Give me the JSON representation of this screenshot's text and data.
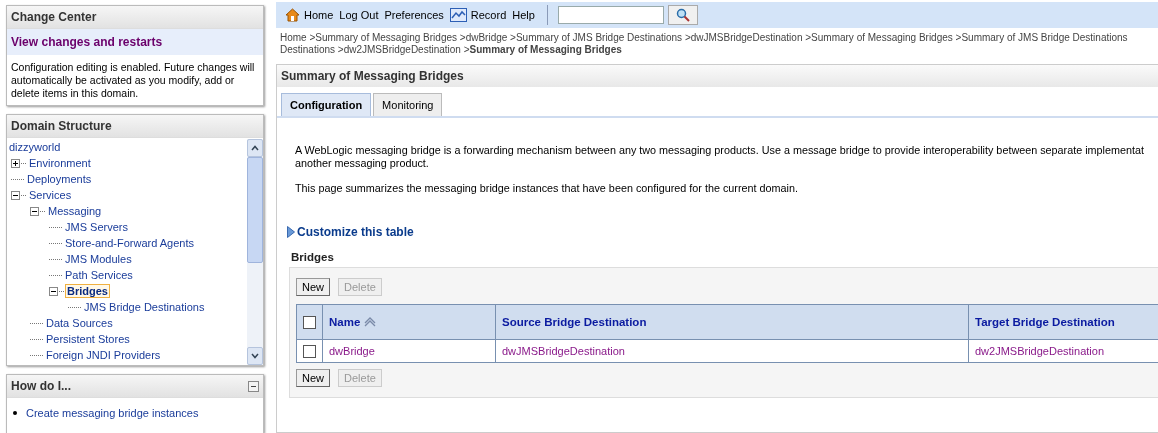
{
  "change_center": {
    "title": "Change Center",
    "link": "View changes and restarts",
    "message": "Configuration editing is enabled. Future changes will automatically be activated as you modify, add or delete items in this domain."
  },
  "domain_structure": {
    "title": "Domain Structure",
    "tree": [
      {
        "label": "dizzyworld",
        "selected": false,
        "children": [
          {
            "label": "Environment",
            "selected": false,
            "expanded": false
          },
          {
            "label": "Deployments",
            "selected": false
          },
          {
            "label": "Services",
            "selected": false,
            "expanded": true,
            "children": [
              {
                "label": "Messaging",
                "selected": false,
                "expanded": true,
                "children": [
                  {
                    "label": "JMS Servers",
                    "selected": false
                  },
                  {
                    "label": "Store-and-Forward Agents",
                    "selected": false
                  },
                  {
                    "label": "JMS Modules",
                    "selected": false
                  },
                  {
                    "label": "Path Services",
                    "selected": false
                  },
                  {
                    "label": "Bridges",
                    "selected": true,
                    "expanded": true,
                    "children": [
                      {
                        "label": "JMS Bridge Destinations",
                        "selected": false
                      }
                    ]
                  }
                ]
              },
              {
                "label": "Data Sources",
                "selected": false
              },
              {
                "label": "Persistent Stores",
                "selected": false
              },
              {
                "label": "Foreign JNDI Providers",
                "selected": false
              }
            ]
          }
        ]
      }
    ]
  },
  "how_do_i": {
    "title": "How do I...",
    "links": [
      "Create messaging bridge instances"
    ]
  },
  "toolbar": {
    "items": [
      "Home",
      "Log Out",
      "Preferences",
      "Record",
      "Help"
    ]
  },
  "breadcrumb": {
    "lines": [
      "Home >Summary of Messaging Bridges >dwBridge >Summary of JMS Bridge Destinations >dwJMSBridgeDestination >Summary of Messaging Bridges >Summary of JMS Bridge Destinations",
      "Destinations >dw2JMSBridgeDestination >**Summary of Messaging Bridges**"
    ]
  },
  "page": {
    "title": "Summary of Messaging Bridges",
    "tabs": [
      {
        "label": "Configuration",
        "selected": true
      },
      {
        "label": "Monitoring",
        "selected": false
      }
    ],
    "description": [
      "A WebLogic messaging bridge is a forwarding mechanism between any two messaging products. Use a message bridge to provide interoperability between separate implementat",
      "another messaging product."
    ],
    "summary": "This page summarizes the messaging bridge instances that have been configured for the current domain.",
    "customize": "Customize this table",
    "table": {
      "title": "Bridges",
      "top_buttons": [
        {
          "label": "New",
          "disabled": false
        },
        {
          "label": "Delete",
          "disabled": true
        }
      ],
      "bottom_buttons": [
        {
          "label": "New",
          "disabled": false
        },
        {
          "label": "Delete",
          "disabled": true
        }
      ],
      "columns": [
        "Name",
        "Source Bridge Destination",
        "Target Bridge Destination"
      ],
      "rows": [
        {
          "checked": false,
          "cells": [
            "dwBridge",
            "dwJMSBridgeDestination",
            "dw2JMSBridgeDestination"
          ]
        }
      ],
      "header_checked": false
    }
  }
}
